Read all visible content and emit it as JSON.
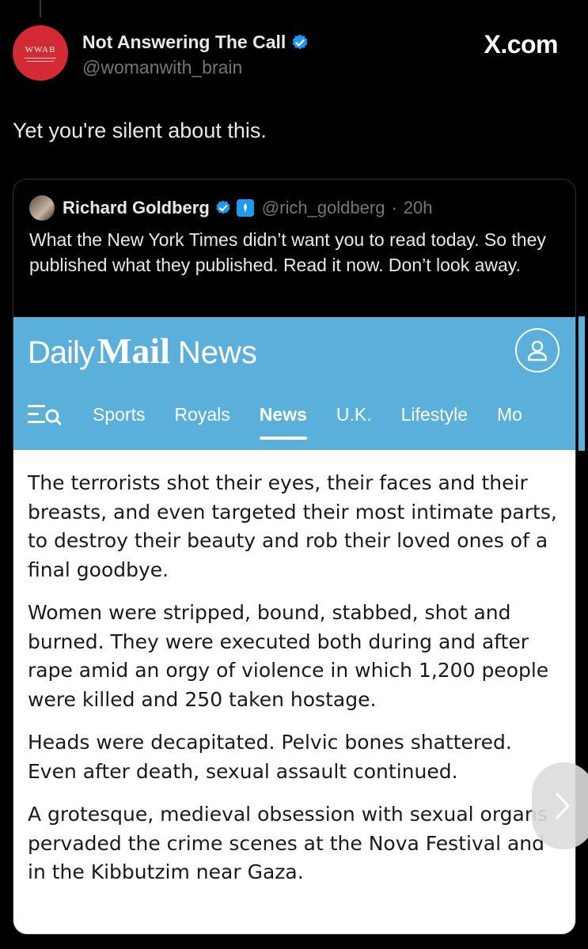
{
  "tweet": {
    "display_name": "Not Answering The Call",
    "handle": "@womanwith_brain",
    "avatar_mono": "WWAB",
    "site": "X.com",
    "text": "Yet you're silent about this."
  },
  "quote": {
    "display_name": "Richard Goldberg",
    "handle": "@rich_goldberg",
    "separator": "·",
    "time": "20h",
    "text": "What the New York Times didn’t want you to read today. So they published what they published. Read it now. Don’t look away."
  },
  "dailymail": {
    "logo": {
      "daily": "Daily",
      "mail": "Mail",
      "news": "News"
    },
    "nav": [
      {
        "label": "Sports"
      },
      {
        "label": "Royals"
      },
      {
        "label": "News",
        "active": true
      },
      {
        "label": "U.K."
      },
      {
        "label": "Lifestyle"
      },
      {
        "label": "Mo"
      }
    ],
    "paragraphs": [
      "The terrorists shot their eyes, their faces and their breasts, and even targeted their most intimate parts, to destroy their beauty and rob their loved ones of a final goodbye.",
      "Women were stripped, bound, stabbed, shot and burned. They were executed both during and after rape amid an orgy of violence in which 1,200 people were killed and 250 taken hostage.",
      "Heads were decapitated. Pelvic bones shattered. Even after death, sexual assault continued.",
      "A grotesque, medieval obsession with sexual organs pervaded the crime scenes at the Nova Festival and in the Kibbutzim near Gaza."
    ]
  },
  "colors": {
    "accent": "#1d9bf0",
    "dailymail_blue": "#5ab0db",
    "avatar_red": "#d42a34"
  },
  "icons": [
    "verified-badge-icon",
    "gov-badge-icon",
    "user-account-icon",
    "menu-search-icon",
    "chevron-right-icon"
  ]
}
